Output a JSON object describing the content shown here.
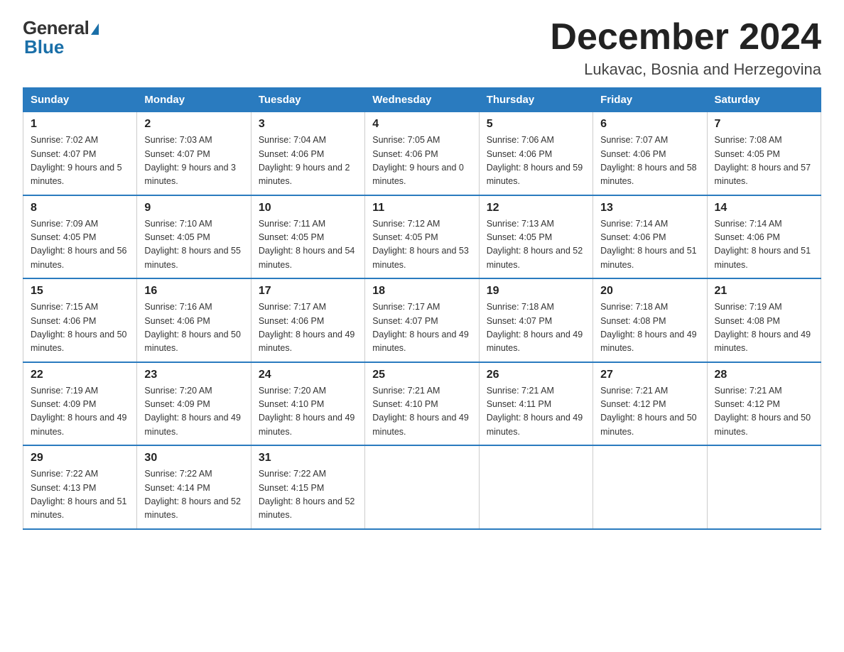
{
  "logo": {
    "text_general": "General",
    "text_blue": "Blue"
  },
  "title": "December 2024",
  "subtitle": "Lukavac, Bosnia and Herzegovina",
  "days_of_week": [
    "Sunday",
    "Monday",
    "Tuesday",
    "Wednesday",
    "Thursday",
    "Friday",
    "Saturday"
  ],
  "weeks": [
    [
      {
        "day": "1",
        "sunrise": "7:02 AM",
        "sunset": "4:07 PM",
        "daylight": "9 hours and 5 minutes."
      },
      {
        "day": "2",
        "sunrise": "7:03 AM",
        "sunset": "4:07 PM",
        "daylight": "9 hours and 3 minutes."
      },
      {
        "day": "3",
        "sunrise": "7:04 AM",
        "sunset": "4:06 PM",
        "daylight": "9 hours and 2 minutes."
      },
      {
        "day": "4",
        "sunrise": "7:05 AM",
        "sunset": "4:06 PM",
        "daylight": "9 hours and 0 minutes."
      },
      {
        "day": "5",
        "sunrise": "7:06 AM",
        "sunset": "4:06 PM",
        "daylight": "8 hours and 59 minutes."
      },
      {
        "day": "6",
        "sunrise": "7:07 AM",
        "sunset": "4:06 PM",
        "daylight": "8 hours and 58 minutes."
      },
      {
        "day": "7",
        "sunrise": "7:08 AM",
        "sunset": "4:05 PM",
        "daylight": "8 hours and 57 minutes."
      }
    ],
    [
      {
        "day": "8",
        "sunrise": "7:09 AM",
        "sunset": "4:05 PM",
        "daylight": "8 hours and 56 minutes."
      },
      {
        "day": "9",
        "sunrise": "7:10 AM",
        "sunset": "4:05 PM",
        "daylight": "8 hours and 55 minutes."
      },
      {
        "day": "10",
        "sunrise": "7:11 AM",
        "sunset": "4:05 PM",
        "daylight": "8 hours and 54 minutes."
      },
      {
        "day": "11",
        "sunrise": "7:12 AM",
        "sunset": "4:05 PM",
        "daylight": "8 hours and 53 minutes."
      },
      {
        "day": "12",
        "sunrise": "7:13 AM",
        "sunset": "4:05 PM",
        "daylight": "8 hours and 52 minutes."
      },
      {
        "day": "13",
        "sunrise": "7:14 AM",
        "sunset": "4:06 PM",
        "daylight": "8 hours and 51 minutes."
      },
      {
        "day": "14",
        "sunrise": "7:14 AM",
        "sunset": "4:06 PM",
        "daylight": "8 hours and 51 minutes."
      }
    ],
    [
      {
        "day": "15",
        "sunrise": "7:15 AM",
        "sunset": "4:06 PM",
        "daylight": "8 hours and 50 minutes."
      },
      {
        "day": "16",
        "sunrise": "7:16 AM",
        "sunset": "4:06 PM",
        "daylight": "8 hours and 50 minutes."
      },
      {
        "day": "17",
        "sunrise": "7:17 AM",
        "sunset": "4:06 PM",
        "daylight": "8 hours and 49 minutes."
      },
      {
        "day": "18",
        "sunrise": "7:17 AM",
        "sunset": "4:07 PM",
        "daylight": "8 hours and 49 minutes."
      },
      {
        "day": "19",
        "sunrise": "7:18 AM",
        "sunset": "4:07 PM",
        "daylight": "8 hours and 49 minutes."
      },
      {
        "day": "20",
        "sunrise": "7:18 AM",
        "sunset": "4:08 PM",
        "daylight": "8 hours and 49 minutes."
      },
      {
        "day": "21",
        "sunrise": "7:19 AM",
        "sunset": "4:08 PM",
        "daylight": "8 hours and 49 minutes."
      }
    ],
    [
      {
        "day": "22",
        "sunrise": "7:19 AM",
        "sunset": "4:09 PM",
        "daylight": "8 hours and 49 minutes."
      },
      {
        "day": "23",
        "sunrise": "7:20 AM",
        "sunset": "4:09 PM",
        "daylight": "8 hours and 49 minutes."
      },
      {
        "day": "24",
        "sunrise": "7:20 AM",
        "sunset": "4:10 PM",
        "daylight": "8 hours and 49 minutes."
      },
      {
        "day": "25",
        "sunrise": "7:21 AM",
        "sunset": "4:10 PM",
        "daylight": "8 hours and 49 minutes."
      },
      {
        "day": "26",
        "sunrise": "7:21 AM",
        "sunset": "4:11 PM",
        "daylight": "8 hours and 49 minutes."
      },
      {
        "day": "27",
        "sunrise": "7:21 AM",
        "sunset": "4:12 PM",
        "daylight": "8 hours and 50 minutes."
      },
      {
        "day": "28",
        "sunrise": "7:21 AM",
        "sunset": "4:12 PM",
        "daylight": "8 hours and 50 minutes."
      }
    ],
    [
      {
        "day": "29",
        "sunrise": "7:22 AM",
        "sunset": "4:13 PM",
        "daylight": "8 hours and 51 minutes."
      },
      {
        "day": "30",
        "sunrise": "7:22 AM",
        "sunset": "4:14 PM",
        "daylight": "8 hours and 52 minutes."
      },
      {
        "day": "31",
        "sunrise": "7:22 AM",
        "sunset": "4:15 PM",
        "daylight": "8 hours and 52 minutes."
      },
      null,
      null,
      null,
      null
    ]
  ],
  "labels": {
    "sunrise": "Sunrise:",
    "sunset": "Sunset:",
    "daylight": "Daylight:"
  }
}
